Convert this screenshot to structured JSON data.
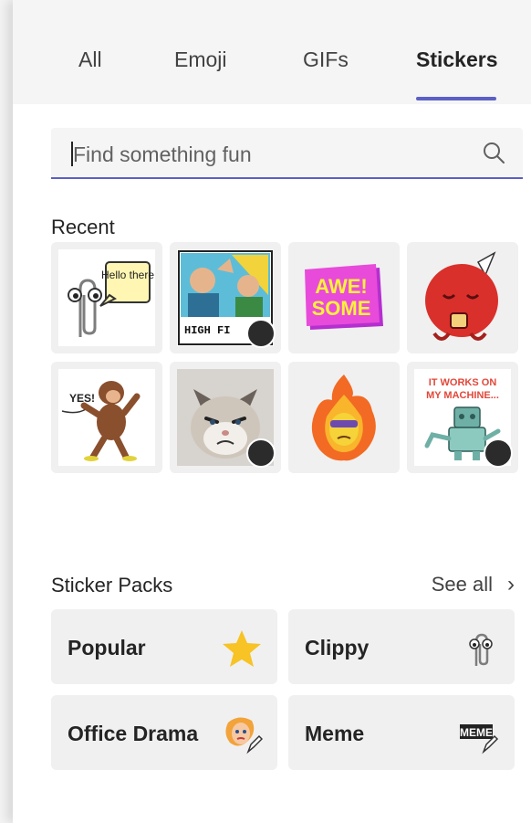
{
  "tabs": [
    {
      "label": "All",
      "active": false
    },
    {
      "label": "Emoji",
      "active": false
    },
    {
      "label": "GIFs",
      "active": false
    },
    {
      "label": "Stickers",
      "active": true
    }
  ],
  "search": {
    "placeholder": "Find something fun",
    "icon": "search-icon"
  },
  "recent": {
    "title": "Recent",
    "stickers": [
      {
        "name": "clippy-hello-there",
        "caption": "Hello there",
        "editable": false
      },
      {
        "name": "high-five-meme",
        "caption": "HIGH FI",
        "editable": true
      },
      {
        "name": "awesome",
        "caption": "AWE! SOME",
        "editable": false
      },
      {
        "name": "red-creature-coffee",
        "editable": false
      },
      {
        "name": "monkey-yes",
        "caption": "YES!",
        "editable": false
      },
      {
        "name": "grumpy-cat",
        "editable": true
      },
      {
        "name": "fire-character",
        "editable": false
      },
      {
        "name": "it-works-on-my-machine",
        "caption": "IT WORKS ON MY MACHINE...",
        "editable": true
      }
    ]
  },
  "packs": {
    "title": "Sticker Packs",
    "see_all": "See all",
    "items": [
      {
        "label": "Popular",
        "icon": "star-icon"
      },
      {
        "label": "Clippy",
        "icon": "paperclip-icon"
      },
      {
        "label": "Office Drama",
        "icon": "drama-face-icon"
      },
      {
        "label": "Meme",
        "icon": "meme-icon"
      }
    ]
  },
  "colors": {
    "accent": "#5b5fc7",
    "tile_bg": "#f0f0f0",
    "tab_bar_bg": "#f5f5f5"
  }
}
